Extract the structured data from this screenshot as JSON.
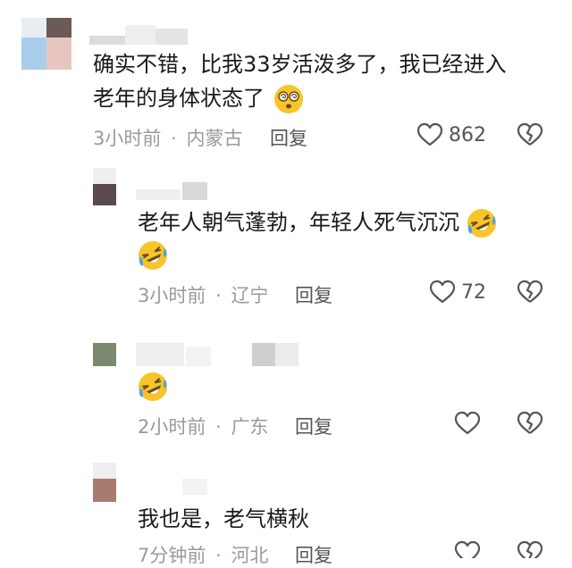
{
  "colors": {
    "text": "#1a1a1a",
    "meta": "#9a9a9a",
    "action": "#555555",
    "emoji_face": "#f7c52a",
    "tears": "#4aa3ea"
  },
  "comments": [
    {
      "text_line1": "确实不错，比我33岁活泼多了，我已经进入",
      "text_line2": "老年的身体状态了",
      "emoji": "dizzy-face",
      "time": "3小时前",
      "separator": "·",
      "location": "内蒙古",
      "reply": "回复",
      "likes": "862"
    },
    {
      "text_line1": "老年人朝气蓬勃，年轻人死气沉沉",
      "emoji": "rolling-on-floor-laughing",
      "time": "3小时前",
      "separator": "·",
      "location": "辽宁",
      "reply": "回复",
      "likes": "72"
    },
    {
      "emoji": "rolling-on-floor-laughing",
      "time": "2小时前",
      "separator": "·",
      "location": "广东",
      "reply": "回复"
    },
    {
      "text_line1": "我也是，老气横秋",
      "time": "7分钟前",
      "separator": "·",
      "location": "河北",
      "reply": "回复"
    }
  ]
}
